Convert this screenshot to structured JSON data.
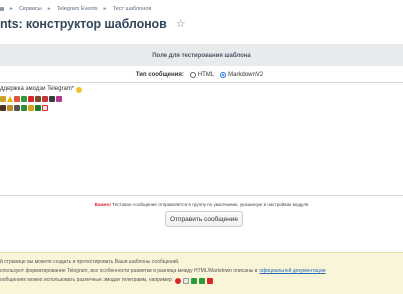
{
  "breadcrumbs": [
    "Сервисы",
    "Telegram Events",
    "Тест шаблонов"
  ],
  "page_title": "nts: конструктор шаблонов",
  "panel": {
    "header": "Поле для тестирования шаблона",
    "message_type_label": "Тип сообщения:",
    "options": [
      "HTML",
      "MarkdownV2"
    ],
    "selected": "MarkdownV2",
    "textarea_line1": "ддержка эмодзи Telegram*"
  },
  "notice": {
    "warn": "Важно!",
    "text": " Тестовое сообщение отправляется в группу по умолчанию, указанную в настройках модуля"
  },
  "submit_label": "Отправить сообщение",
  "info": {
    "line1": "й странице вы можете создать и протестировать Ваши шаблоны сообщений.",
    "line2_prefix": "спользуют форматирование Telegram, все особенности разметки и разница между HTML/Markdown описаны в",
    "line2_link": "официальной документации",
    "line3": "ообщениях можно использовать различные эмодзи телеграмм, например:"
  },
  "colors": {
    "accent": "#1a73e8",
    "warn": "#d9262c",
    "info_bg": "#f8f5d8",
    "panel_header_bg": "#e8ebee"
  }
}
